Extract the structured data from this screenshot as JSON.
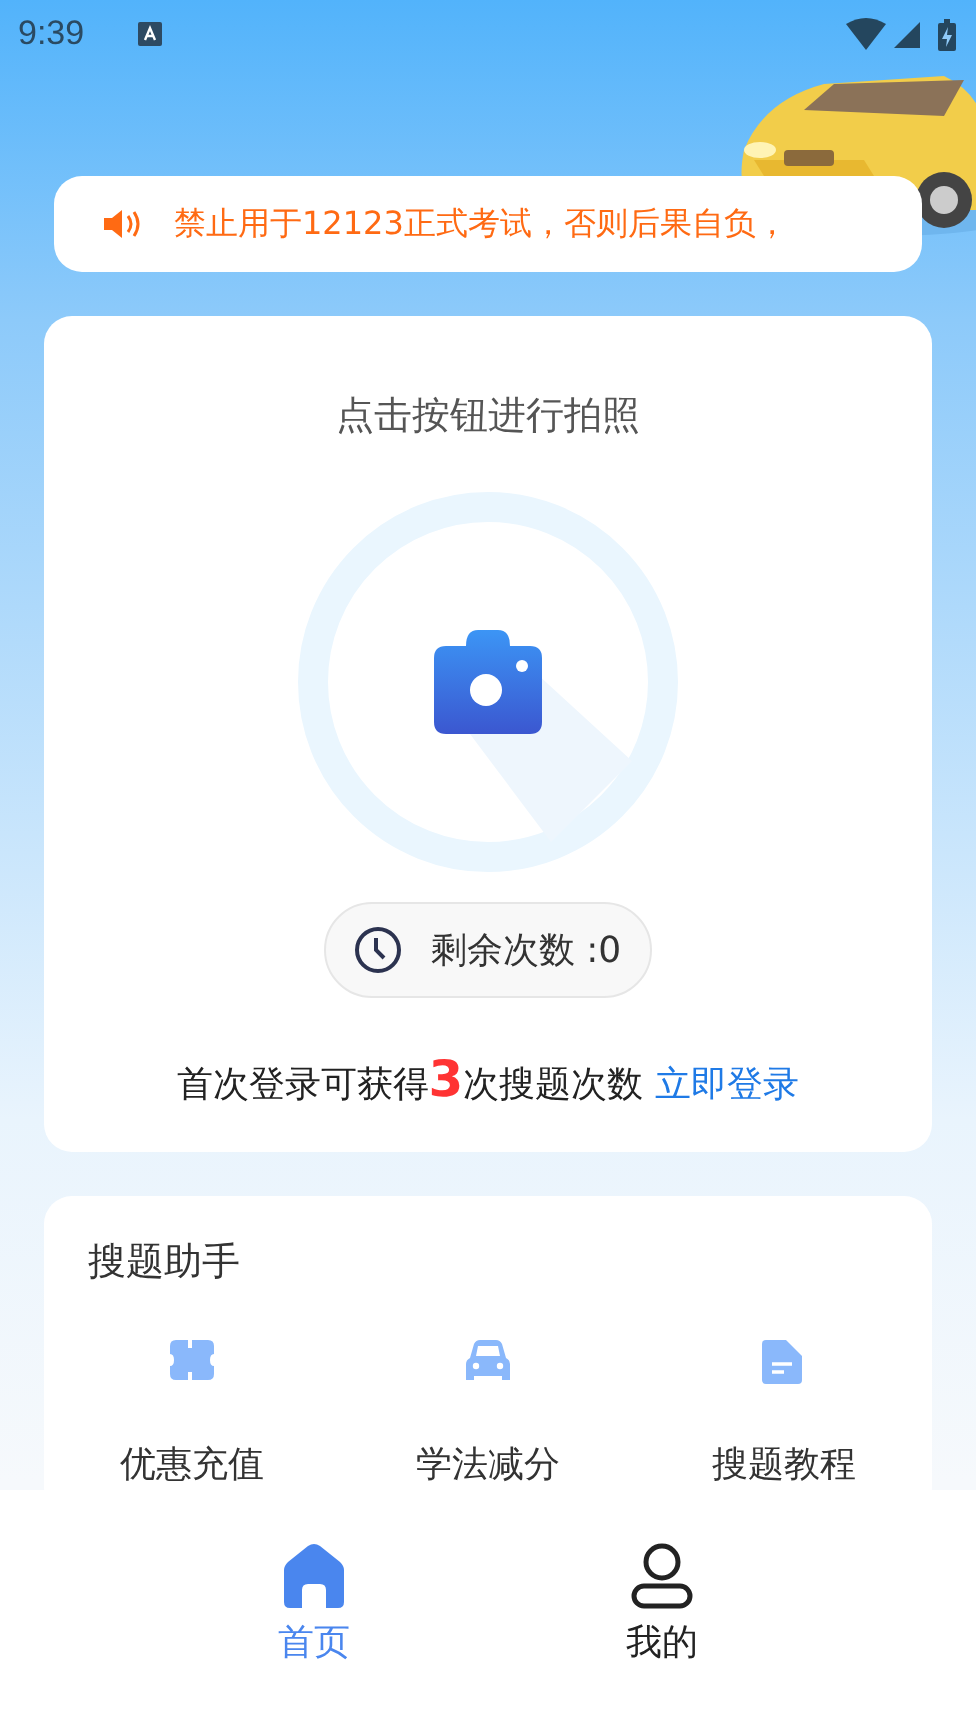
{
  "status_bar": {
    "time": "9:39"
  },
  "notice": {
    "text": "禁止用于12123正式考试，否则后果自负，"
  },
  "camera_card": {
    "title": "点击按钮进行拍照",
    "remaining": "剩余次数 :0",
    "login_prompt": "首次登录可获得**3**次搜题次数",
    "login_link": "立即登录"
  },
  "helper": {
    "title": "搜题助手",
    "items": [
      {
        "kind": "ticket",
        "label": "优惠充值"
      },
      {
        "kind": "car",
        "label": "学法减分"
      },
      {
        "kind": "document",
        "label": "搜题教程"
      }
    ]
  },
  "tabs": [
    {
      "kind": "home",
      "label": "首页",
      "selected": true
    },
    {
      "kind": "user",
      "label": "我的",
      "selected": false
    }
  ]
}
